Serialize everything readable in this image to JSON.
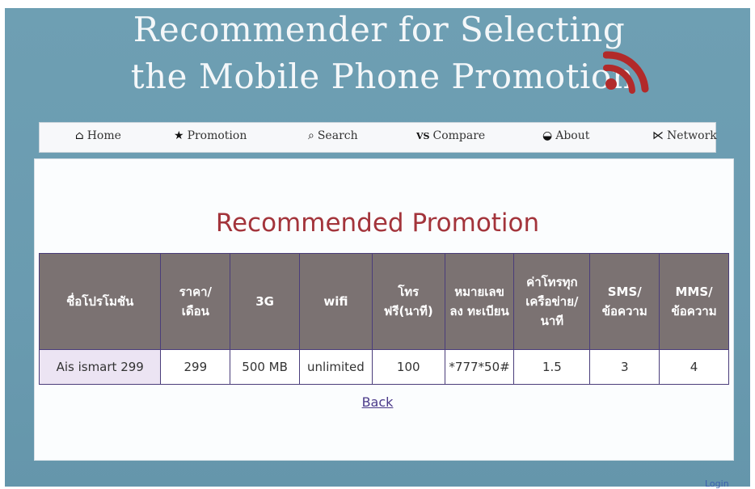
{
  "header": {
    "title_line1": "Recommender for Selecting",
    "title_line2": "the Mobile Phone Promotion",
    "logo_icon": "rss-feed-icon",
    "logo_color": "#b22a2a"
  },
  "nav": {
    "items": [
      {
        "label": "Home",
        "icon": "home-icon",
        "glyph": "⌂"
      },
      {
        "label": "Promotion",
        "icon": "star-icon",
        "glyph": "★"
      },
      {
        "label": "Search",
        "icon": "search-icon",
        "glyph": "⌕"
      },
      {
        "label": "Compare",
        "icon": "versus-icon",
        "glyph": "VS"
      },
      {
        "label": "About",
        "icon": "binoculars-icon",
        "glyph": "◒"
      },
      {
        "label": "Network",
        "icon": "rss-icon",
        "glyph": "⋉"
      }
    ]
  },
  "main": {
    "heading": "Recommended Promotion",
    "table": {
      "headers": [
        "ชื่อโปรโมชัน",
        "ราคา/ เดือน",
        "3G",
        "wifi",
        "โทร ฟรี(นาที)",
        "หมายเลข ลง ทะเบียน",
        "ค่าโทรทุก เครือข่าย/ นาที",
        "SMS/ ข้อความ",
        "MMS/ ข้อความ"
      ],
      "rows": [
        [
          "Ais ismart 299",
          "299",
          "500 MB",
          "unlimited",
          "100",
          "*777*50#",
          "1.5",
          "3",
          "4"
        ]
      ]
    },
    "back_label": "Back"
  },
  "footer": {
    "login_label": "Login"
  },
  "colors": {
    "background": "#6e9fb3",
    "heading": "#a3343b",
    "table_header": "#7b7272",
    "table_border": "#4a3d7a",
    "link": "#4b3a8a"
  }
}
